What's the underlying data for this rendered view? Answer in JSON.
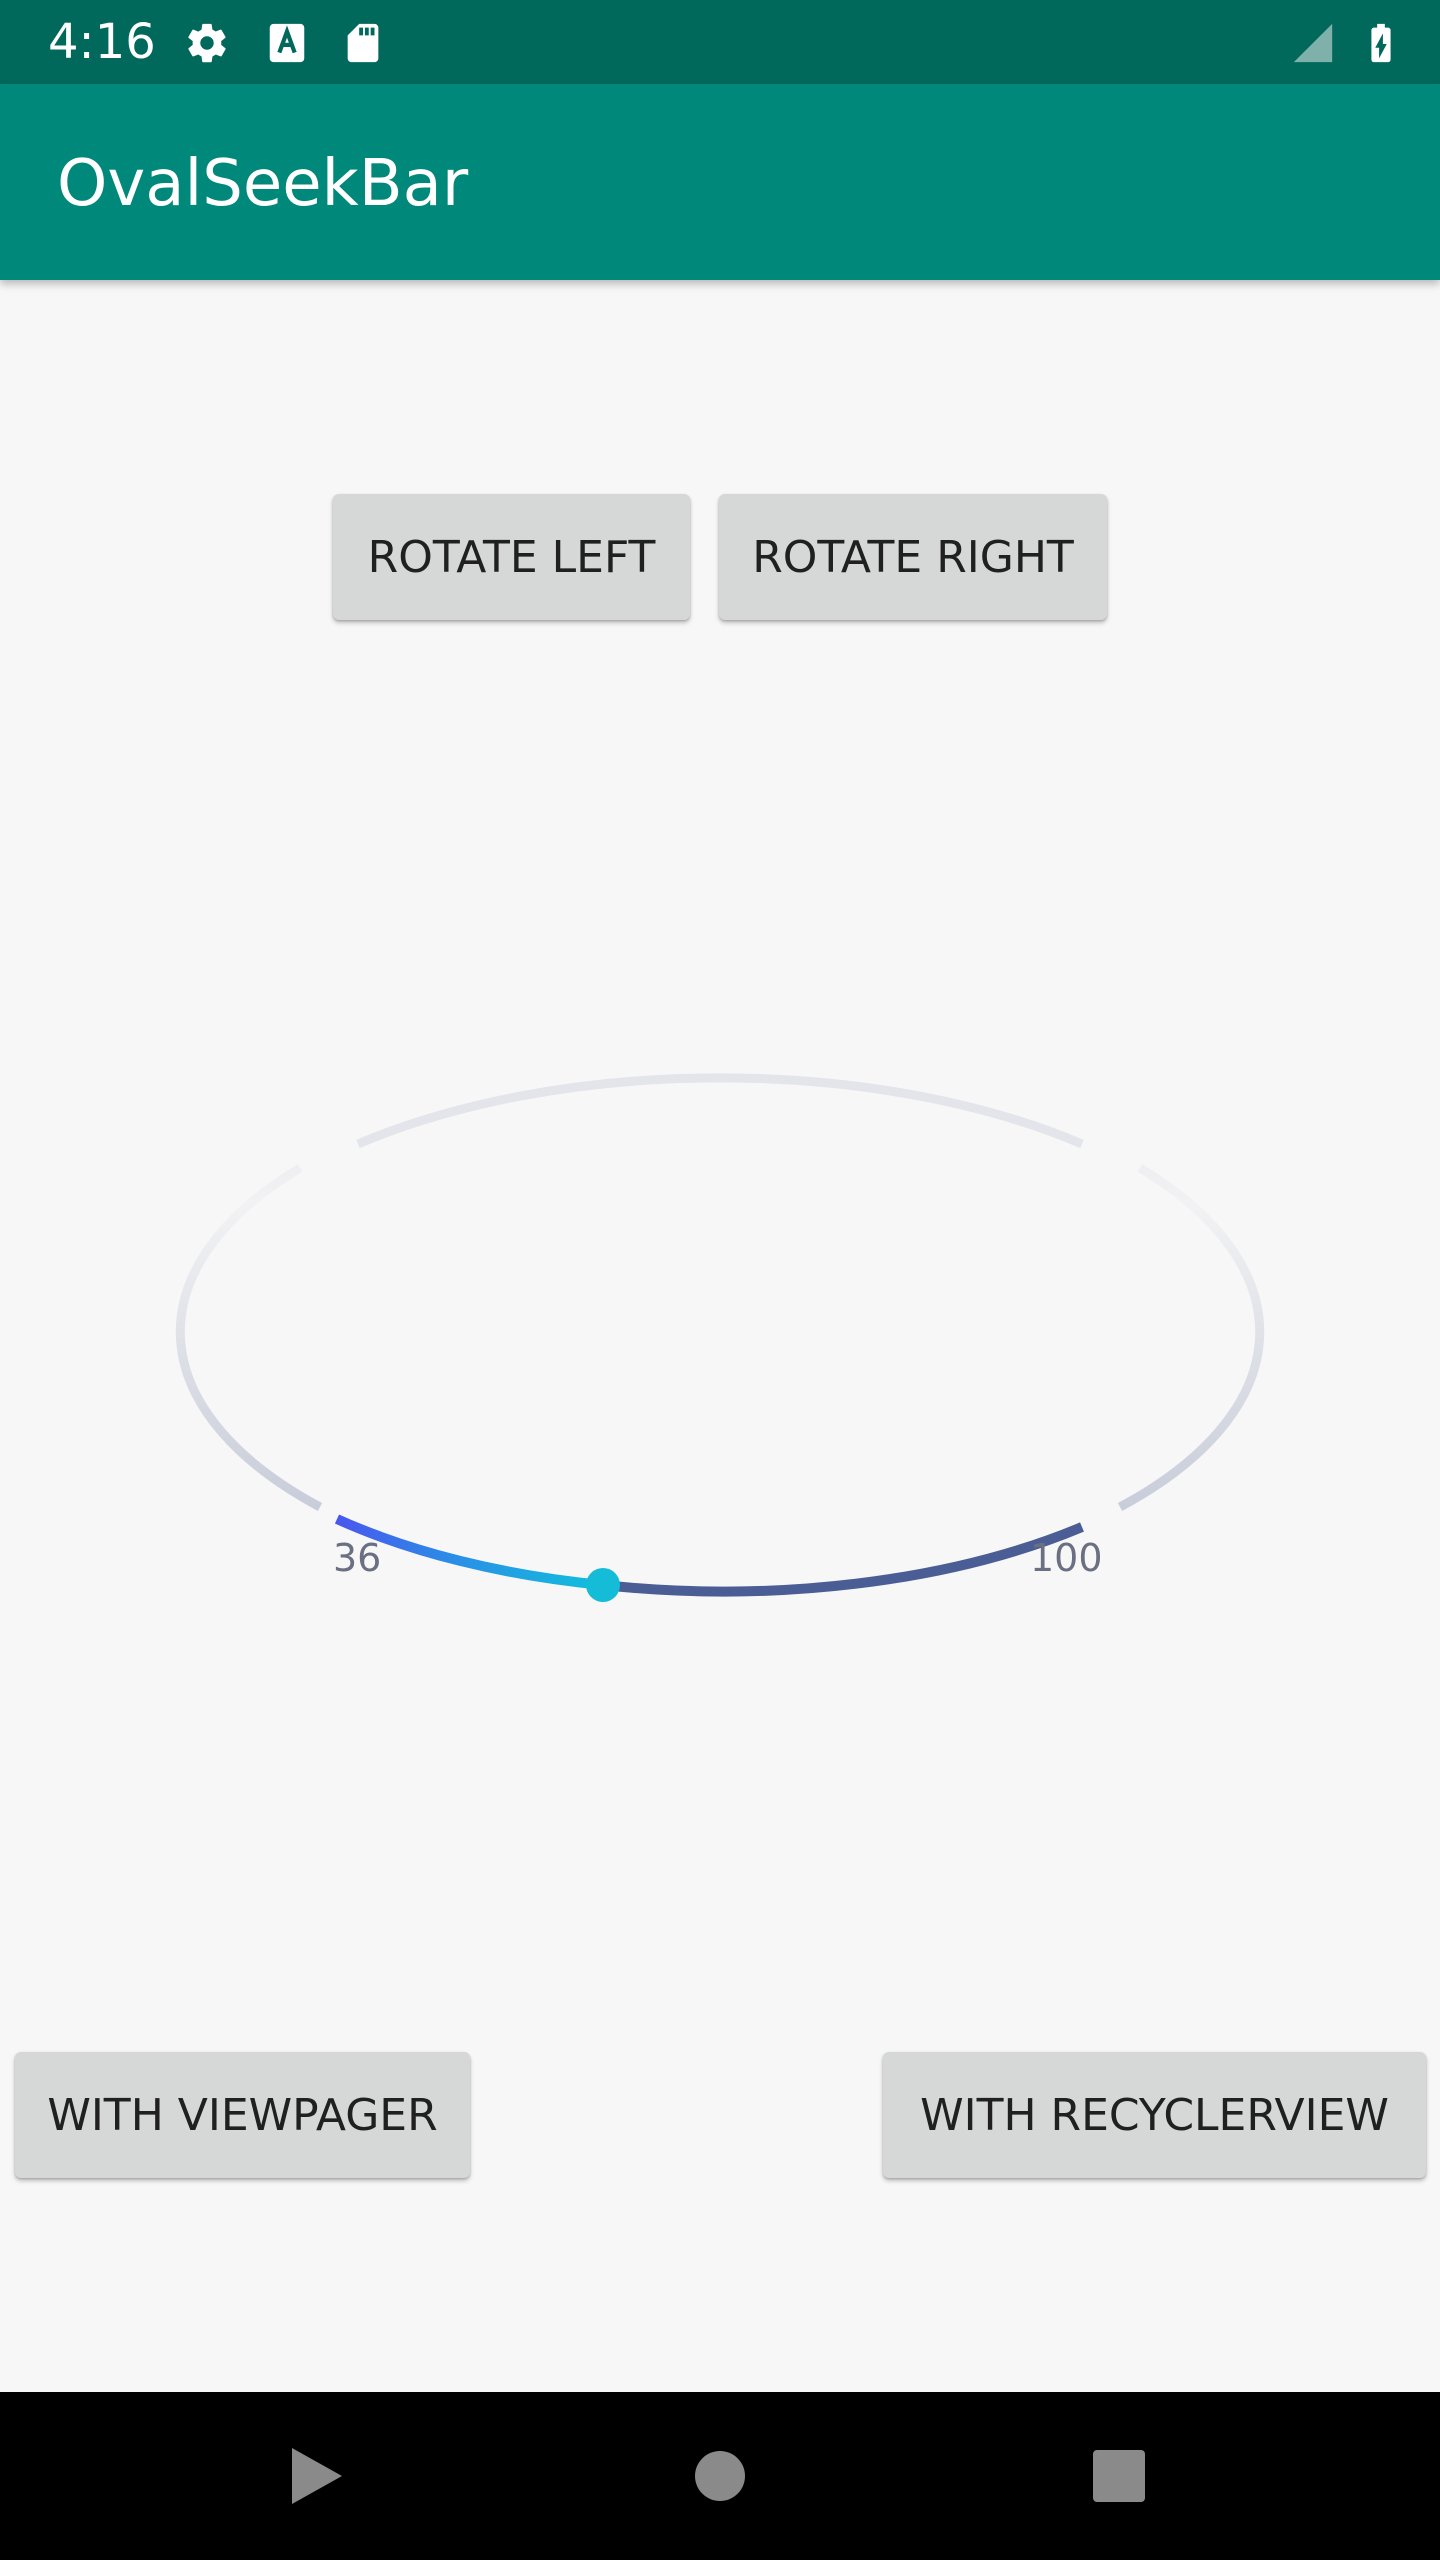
{
  "status_bar": {
    "time": "4:16",
    "icons": [
      "gear-icon",
      "font-a-icon",
      "sd-card-icon",
      "signal-icon",
      "battery-charging-icon"
    ],
    "background": "#00695c"
  },
  "app_bar": {
    "title": "OvalSeekBar",
    "background": "#00897b"
  },
  "controls": {
    "rotate_left_label": "ROTATE LEFT",
    "rotate_right_label": "ROTATE RIGHT"
  },
  "oval_seekbar": {
    "min_label": "36",
    "max_label": "100",
    "progress_fraction": 0.4,
    "track_color": "#c8ccd8",
    "progress_gradient": [
      "#4a5cf0",
      "#25a8e0",
      "#10c0dc"
    ],
    "remaining_color": "#4a5d95",
    "thumb_color": "#14bcd8"
  },
  "bottom_buttons": {
    "viewpager_label": "WITH VIEWPAGER",
    "recyclerview_label": "WITH RECYCLERVIEW"
  },
  "nav_bar": {
    "icons": [
      "back-icon",
      "home-icon",
      "recents-icon"
    ]
  }
}
